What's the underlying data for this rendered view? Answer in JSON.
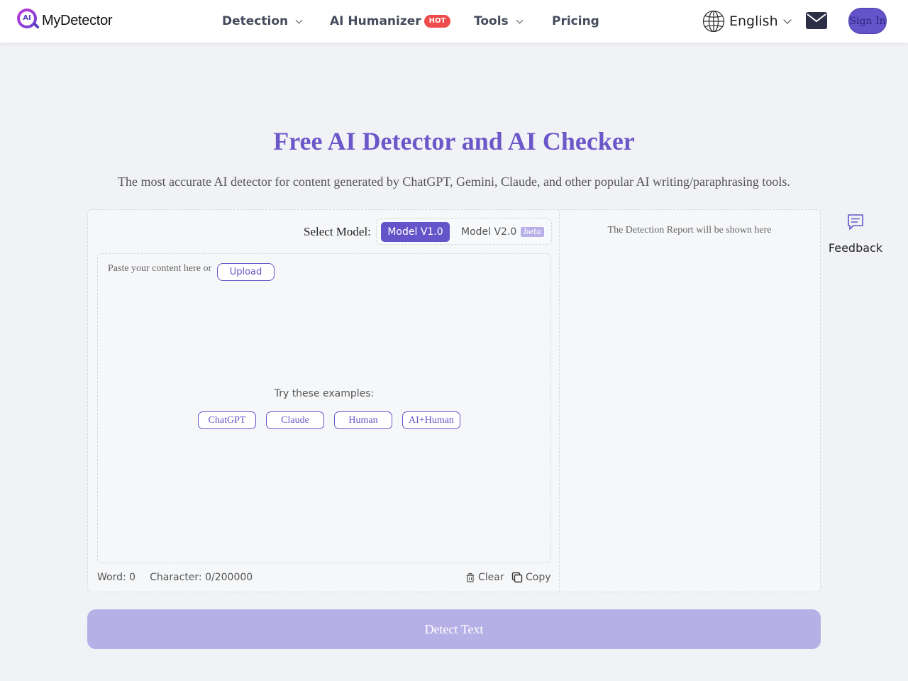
{
  "header": {
    "logo_badge": "AI",
    "logo_text": "MyDetector",
    "nav": {
      "detection": "Detection",
      "humanizer": "AI Humanizer",
      "hot_badge": "HOT",
      "tools": "Tools",
      "pricing": "Pricing"
    },
    "language": "English",
    "signin": "Sign In"
  },
  "hero": {
    "title": "Free AI Detector and AI Checker",
    "subtitle": "The most accurate AI detector for content generated by ChatGPT, Gemini, Claude, and other popular AI writing/paraphrasing tools."
  },
  "editor": {
    "model_label": "Select Model:",
    "models": [
      {
        "label": "Model V1.0",
        "selected": true
      },
      {
        "label": "Model V2.0",
        "badge": "beta",
        "selected": false
      }
    ],
    "placeholder": "Paste your content here or",
    "upload": "Upload",
    "examples_label": "Try these examples:",
    "examples": [
      "ChatGPT",
      "Claude",
      "Human",
      "AI+Human"
    ],
    "word_count": "Word: 0",
    "char_count": "Character: 0/200000",
    "clear": "Clear",
    "copy": "Copy"
  },
  "report": {
    "placeholder": "The Detection Report will be shown here"
  },
  "feedback": {
    "label": "Feedback"
  },
  "detect_button": "Detect Text",
  "colors": {
    "accent": "#6554c9",
    "accent_disabled": "#b7b0e6",
    "hot": "#ee4b4b",
    "background": "#f1f2f6"
  }
}
